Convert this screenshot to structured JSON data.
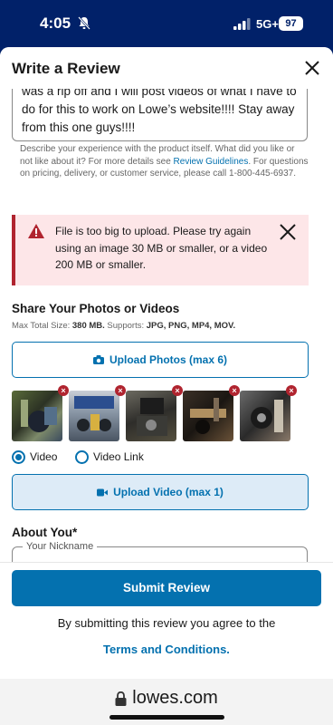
{
  "status_bar": {
    "time": "4:05",
    "network": "5G+",
    "battery": "97"
  },
  "header": {
    "title": "Write a Review"
  },
  "review": {
    "text": "was a rip off and I will post videos of what I have to do for this to work on Lowe’s website!!!! Stay away from this one guys!!!!"
  },
  "helper": {
    "text_before": "Describe your experience with the product itself. What did you like or not like about it? For more details see ",
    "link": "Review Guidelines",
    "text_after": ". For questions on pricing, delivery, or customer service, please call 1-800-445-6937."
  },
  "error": {
    "message": "File is too big to upload. Please try again using an image 30 MB or smaller, or a video 200 MB or smaller.",
    "color": "#b0242f"
  },
  "media": {
    "title": "Share Your Photos or Videos",
    "max_label": "Max Total Size: ",
    "max_value": "380 MB.",
    "supports_label": " Supports: ",
    "supports_value": "JPG, PNG, MP4, MOV.",
    "upload_photos": "Upload Photos (max 6)",
    "thumbnail_count": 5,
    "video_option": "Video",
    "video_link_option": "Video Link",
    "upload_video": "Upload Video (max 1)"
  },
  "about": {
    "title": "About You*",
    "nickname_label": "Your Nickname"
  },
  "footer": {
    "submit": "Submit Review",
    "agree": "By submitting this review you agree to the",
    "terms": "Terms and Conditions."
  },
  "browser": {
    "url": "lowes.com"
  },
  "colors": {
    "brand_navy": "#012169",
    "accent_blue": "#0471af",
    "error_red": "#b0242f"
  }
}
